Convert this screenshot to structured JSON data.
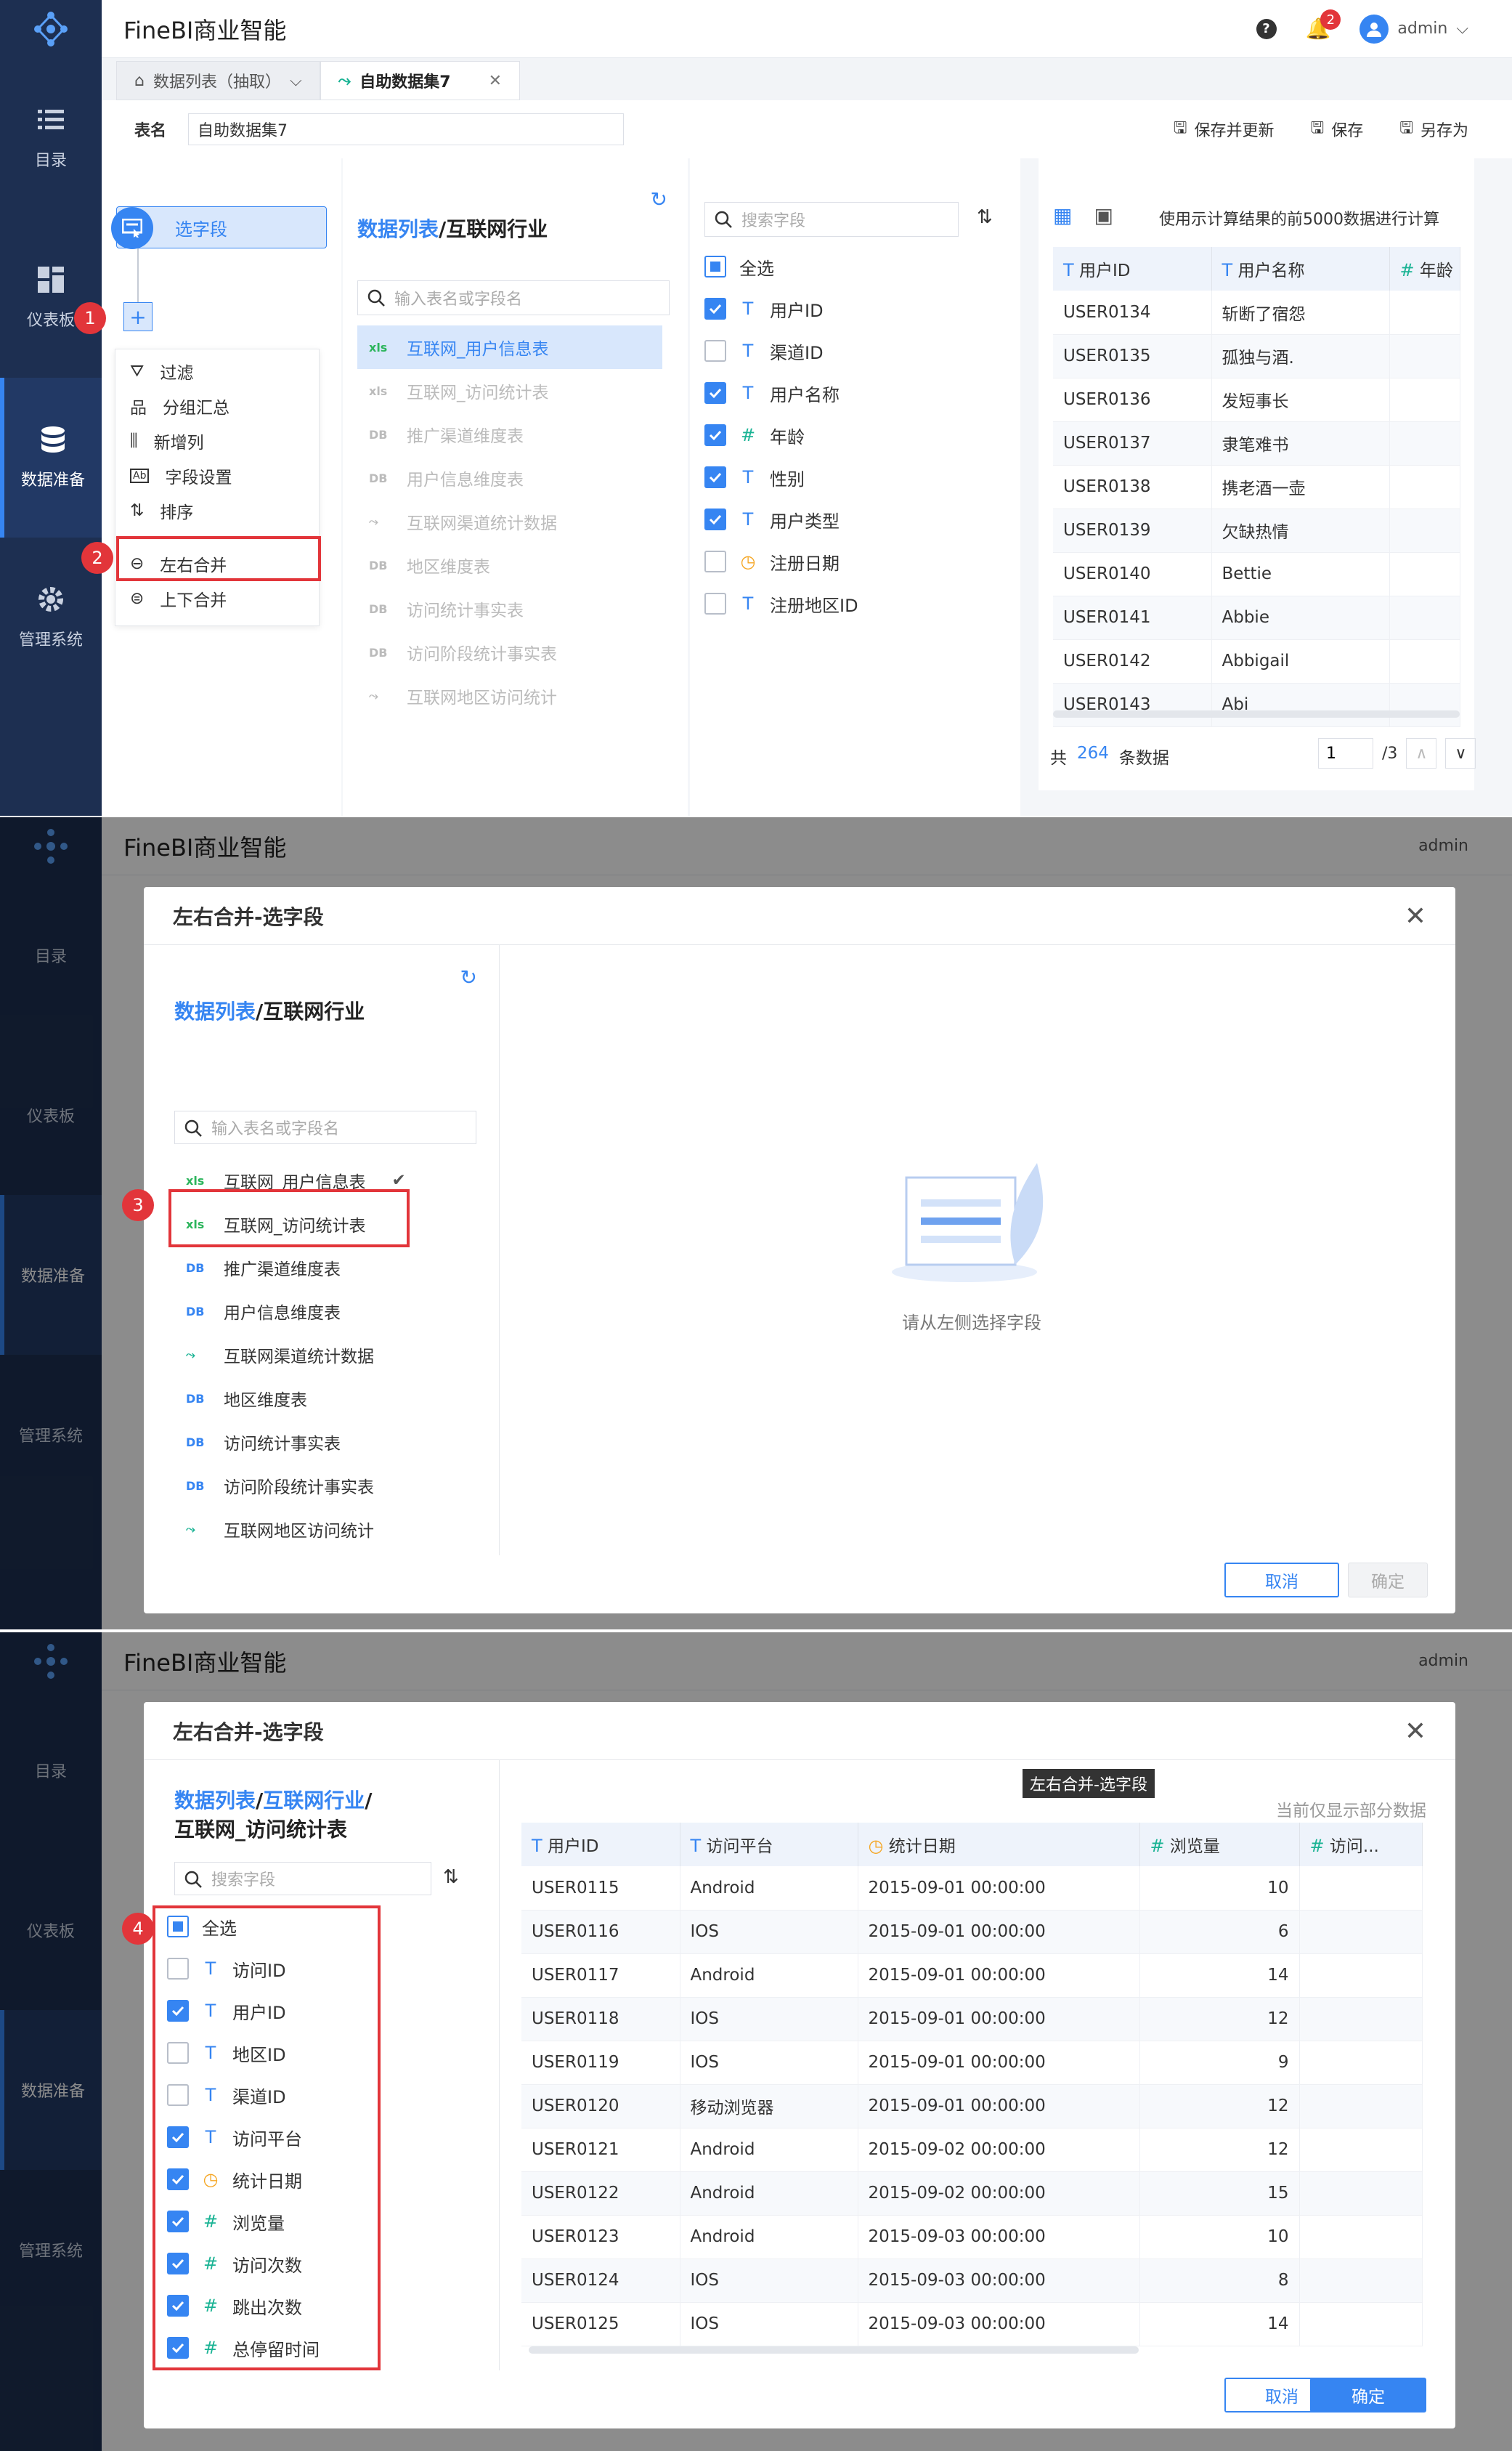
{
  "app": {
    "title": "FineBI商业智能",
    "user": "admin",
    "notif_count": "2"
  },
  "sidebar": {
    "items": [
      {
        "label": "目录",
        "icon": "list-icon"
      },
      {
        "label": "仪表板",
        "icon": "dashboard-icon"
      },
      {
        "label": "数据准备",
        "icon": "database-icon"
      },
      {
        "label": "管理系统",
        "icon": "gear-icon"
      }
    ]
  },
  "tabs": [
    {
      "label": "数据列表（抽取）"
    },
    {
      "label": "自助数据集7"
    }
  ],
  "namebar": {
    "label": "表名",
    "value": "自助数据集7",
    "save_update": "保存并更新",
    "save": "保存",
    "save_as": "另存为"
  },
  "steps": {
    "select_field": "选字段"
  },
  "op_menu": {
    "items": [
      "过滤",
      "分组汇总",
      "新增列",
      "字段设置",
      "排序"
    ],
    "merge_items": [
      "左右合并",
      "上下合并"
    ]
  },
  "markers": [
    "1",
    "2",
    "3",
    "4"
  ],
  "source": {
    "crumb_link": "数据列表",
    "crumb_rest": "/互联网行业",
    "search_placeholder": "输入表名或字段名",
    "tables": [
      {
        "name": "互联网_用户信息表",
        "tag": "xls"
      },
      {
        "name": "互联网_访问统计表",
        "tag": "xls"
      },
      {
        "name": "推广渠道维度表",
        "tag": "DB"
      },
      {
        "name": "用户信息维度表",
        "tag": "DB"
      },
      {
        "name": "互联网渠道统计数据",
        "tag": "line"
      },
      {
        "name": "地区维度表",
        "tag": "DB"
      },
      {
        "name": "访问统计事实表",
        "tag": "DB"
      },
      {
        "name": "访问阶段统计事实表",
        "tag": "DB"
      },
      {
        "name": "互联网地区访问统计",
        "tag": "line"
      }
    ]
  },
  "fields1": {
    "search_placeholder": "搜索字段",
    "select_all": "全选",
    "items": [
      {
        "name": "用户ID",
        "type": "T",
        "checked": true
      },
      {
        "name": "渠道ID",
        "type": "T",
        "checked": false
      },
      {
        "name": "用户名称",
        "type": "T",
        "checked": true
      },
      {
        "name": "年龄",
        "type": "#",
        "checked": true
      },
      {
        "name": "性别",
        "type": "T",
        "checked": true
      },
      {
        "name": "用户类型",
        "type": "T",
        "checked": true
      },
      {
        "name": "注册日期",
        "type": "date",
        "checked": false
      },
      {
        "name": "注册地区ID",
        "type": "T",
        "checked": false
      }
    ]
  },
  "preview1": {
    "toolbar_text": "使用示计算结果的前5000数据进行计算",
    "columns": [
      "用户ID",
      "用户名称",
      "年龄"
    ],
    "rows": [
      [
        "USER0134",
        "斩断了宿怨"
      ],
      [
        "USER0135",
        "孤独与酒."
      ],
      [
        "USER0136",
        "发短事长"
      ],
      [
        "USER0137",
        "隶笔难书"
      ],
      [
        "USER0138",
        "携老酒一壶"
      ],
      [
        "USER0139",
        "欠缺热情"
      ],
      [
        "USER0140",
        "Bettie"
      ],
      [
        "USER0141",
        "Abbie"
      ],
      [
        "USER0142",
        "Abbigail"
      ],
      [
        "USER0143",
        "Abi"
      ]
    ],
    "footer_prefix": "共",
    "footer_count": "264",
    "footer_suffix": "条数据",
    "page_value": "1",
    "page_total": "/3"
  },
  "dialog2": {
    "title": "左右合并-选字段",
    "crumb_link": "数据列表",
    "crumb_rest": "/互联网行业",
    "search_placeholder": "输入表名或字段名",
    "empty_hint": "请从左侧选择字段",
    "cancel": "取消",
    "ok": "确定"
  },
  "dialog3": {
    "title": "左右合并-选字段",
    "tooltip": "左右合并-选字段",
    "crumb_link1": "数据列表",
    "crumb_link2": "互联网行业",
    "crumb_tail": "互联网_访问统计表",
    "note": "当前仅显示部分数据",
    "search_placeholder": "搜索字段",
    "select_all": "全选",
    "fields": [
      {
        "name": "访问ID",
        "type": "T",
        "checked": false
      },
      {
        "name": "用户ID",
        "type": "T",
        "checked": true
      },
      {
        "name": "地区ID",
        "type": "T",
        "checked": false
      },
      {
        "name": "渠道ID",
        "type": "T",
        "checked": false
      },
      {
        "name": "访问平台",
        "type": "T",
        "checked": true
      },
      {
        "name": "统计日期",
        "type": "date",
        "checked": true
      },
      {
        "name": "浏览量",
        "type": "#",
        "checked": true
      },
      {
        "name": "访问次数",
        "type": "#",
        "checked": true
      },
      {
        "name": "跳出次数",
        "type": "#",
        "checked": true
      },
      {
        "name": "总停留时间",
        "type": "#",
        "checked": true
      }
    ],
    "columns": [
      "用户ID",
      "访问平台",
      "统计日期",
      "浏览量",
      "访问..."
    ],
    "rows": [
      [
        "USER0115",
        "Android",
        "2015-09-01 00:00:00",
        "10"
      ],
      [
        "USER0116",
        "IOS",
        "2015-09-01 00:00:00",
        "6"
      ],
      [
        "USER0117",
        "Android",
        "2015-09-01 00:00:00",
        "14"
      ],
      [
        "USER0118",
        "IOS",
        "2015-09-01 00:00:00",
        "12"
      ],
      [
        "USER0119",
        "IOS",
        "2015-09-01 00:00:00",
        "9"
      ],
      [
        "USER0120",
        "移动浏览器",
        "2015-09-01 00:00:00",
        "12"
      ],
      [
        "USER0121",
        "Android",
        "2015-09-02 00:00:00",
        "12"
      ],
      [
        "USER0122",
        "Android",
        "2015-09-02 00:00:00",
        "15"
      ],
      [
        "USER0123",
        "Android",
        "2015-09-03 00:00:00",
        "10"
      ],
      [
        "USER0124",
        "IOS",
        "2015-09-03 00:00:00",
        "8"
      ],
      [
        "USER0125",
        "IOS",
        "2015-09-03 00:00:00",
        "14"
      ]
    ],
    "cancel": "取消",
    "ok": "确定"
  },
  "colors": {
    "sidebar": "#1d2f51",
    "accent": "#3685f2",
    "marker": "#e2353a"
  }
}
